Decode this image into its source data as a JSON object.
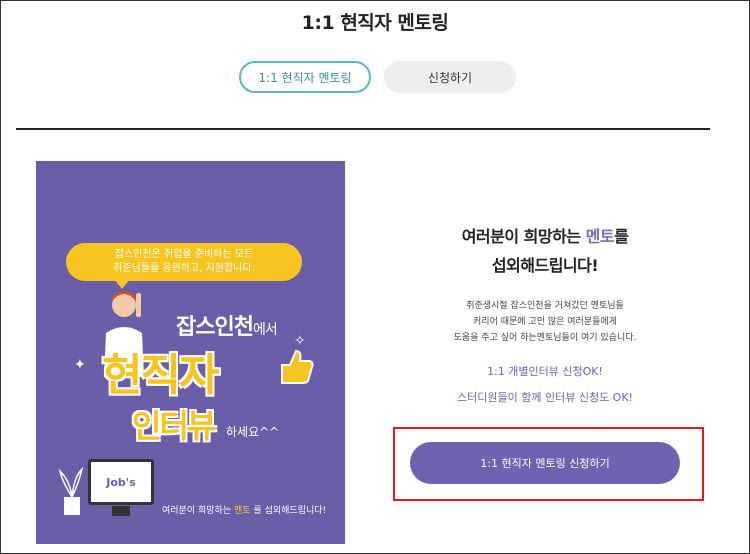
{
  "page": {
    "title": "1:1 현직자 멘토링"
  },
  "tabs": {
    "mentoring": "1:1 현직자 멘토링",
    "apply": "신청하기"
  },
  "poster": {
    "speech_line1": "잡스인천은 취업을 준비하는 모든",
    "speech_line2": "취준님들을 응원하고, 지원합니다.",
    "brand_main": "잡스인천",
    "brand_suffix": "에서",
    "headline1": "현직자",
    "headline2": "인터뷰",
    "tail": "하세요^^",
    "monitor_logo": "Job's",
    "footer_pre": "여러분이 희망하는",
    "footer_hl": "멘토",
    "footer_post": "를 섭외해드립니다!"
  },
  "main": {
    "headline_pre": "여러분이 희망하는",
    "headline_accent": "멘토",
    "headline_post": "를",
    "headline_line2": "섭외해드립니다!",
    "desc_line1": "취준생시절 잡스인천을 거쳐갔던 멘토님들",
    "desc_line2": "커리어 때문에 고민 많은 여러분들에게",
    "desc_line3": "도움을 주고 싶어 하는멘토님들이 여기 있습니다.",
    "bullet1": "1:1 개별인터뷰 신청OK!",
    "bullet2": "스터디원들이 함께 인터뷰 신청도 OK!",
    "cta_label": "1:1 현직자 멘토링 신청하기"
  },
  "colors": {
    "accent": "#6f63b1",
    "highlight": "#e01b1b",
    "poster_bg": "#6b5ea8",
    "poster_yellow": "#f7c420"
  }
}
